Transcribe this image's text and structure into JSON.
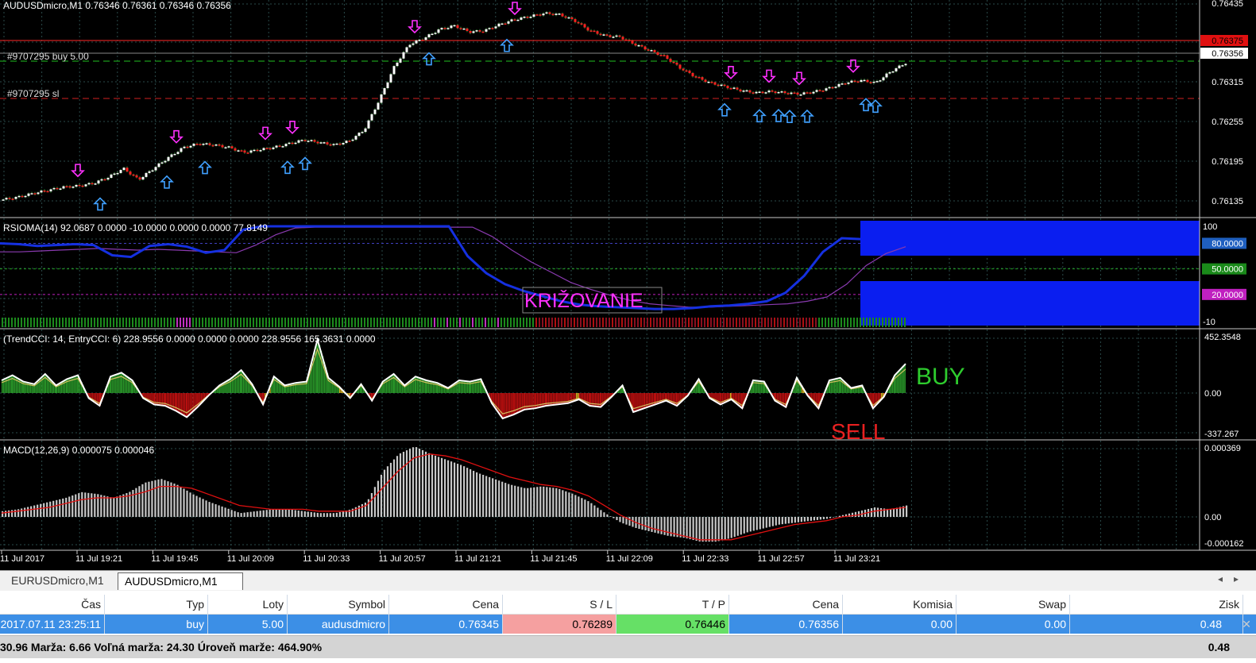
{
  "window": {
    "symbol_title": "AUDUSDmicro,M1  0.76346 0.76361 0.76346 0.76356",
    "bg_color": "#000000",
    "grid_color": "#2a4a4a",
    "bull_color": "#ffffff",
    "bear_color": "#ff2020",
    "up_arrow_color": "#40a0ff",
    "down_arrow_color": "#ff30ff"
  },
  "main_chart": {
    "order_label": "#9707295 buy 5.00",
    "sl_label": "#9707295 sl",
    "price_scale": [
      "0.76435",
      "0.76375",
      "0.76356",
      "0.76315",
      "0.76255",
      "0.76195",
      "0.76135"
    ],
    "current_price": "0.76356",
    "red_line_price": "0.76375",
    "close_series": [
      0.7613,
      0.76134,
      0.7614,
      0.76145,
      0.7615,
      0.76152,
      0.76156,
      0.76166,
      0.7618,
      0.76162,
      0.7618,
      0.76198,
      0.76214,
      0.7622,
      0.76218,
      0.76214,
      0.76206,
      0.7621,
      0.76214,
      0.7622,
      0.76226,
      0.76222,
      0.76218,
      0.76224,
      0.76242,
      0.7629,
      0.76344,
      0.7638,
      0.7639,
      0.76404,
      0.7641,
      0.764,
      0.76402,
      0.76412,
      0.7642,
      0.76425,
      0.7643,
      0.76428,
      0.76418,
      0.76402,
      0.76394,
      0.76392,
      0.7638,
      0.7637,
      0.7636,
      0.76342,
      0.76328,
      0.76318,
      0.76312,
      0.76306,
      0.76302,
      0.76304,
      0.76302,
      0.763,
      0.76304,
      0.7631,
      0.76318,
      0.76322,
      0.76318,
      0.76336,
      0.7635
    ],
    "buy_arrows_x": [
      126,
      210,
      258,
      362,
      384,
      540,
      638,
      912,
      956,
      980,
      994,
      1016,
      1090,
      1102
    ],
    "sell_arrows_x": [
      98,
      222,
      334,
      368,
      522,
      648,
      920,
      968,
      1006,
      1074
    ]
  },
  "rsioma": {
    "label": "RSIOMA(14) 92.0687 0.0000 -10.0000 0.0000 0.0000 77.8149",
    "scale": [
      "100",
      "80.0000",
      "50.0000",
      "20.0000",
      "-10"
    ],
    "annotation": "KRIŽOVANIE",
    "line_series": [
      80,
      79,
      77,
      78,
      79,
      78,
      66,
      64,
      77,
      79,
      76,
      69,
      72,
      96,
      100,
      100,
      100,
      100,
      100,
      100,
      100,
      100,
      100,
      100,
      100,
      65,
      45,
      32,
      24,
      18,
      12,
      8,
      6,
      5,
      4,
      3,
      3,
      4,
      6,
      7,
      9,
      12,
      22,
      42,
      70,
      86,
      85
    ],
    "signal_series": [
      70,
      70,
      71,
      72,
      73,
      74,
      73,
      72,
      73,
      72,
      71,
      70,
      69,
      78,
      90,
      98,
      99,
      99,
      99,
      99,
      99,
      99,
      99,
      99,
      99,
      88,
      72,
      58,
      46,
      34,
      26,
      19,
      13,
      9,
      7,
      5,
      5,
      6,
      7,
      8,
      9,
      12,
      17,
      32,
      54,
      68,
      76
    ]
  },
  "cci": {
    "label": "(TrendCCI: 14, EntryCCI: 6)  228.9556 0.0000 0.0000 0.0000 228.9556 165.3631 0.0000",
    "scale": [
      "452.3548",
      "0.00",
      "-337.267"
    ],
    "buy_text": "BUY",
    "sell_text": "SELL",
    "series": [
      100,
      140,
      90,
      70,
      150,
      60,
      110,
      140,
      -40,
      -100,
      130,
      160,
      100,
      -40,
      -90,
      -100,
      -140,
      -190,
      -110,
      -20,
      60,
      110,
      180,
      70,
      -90,
      130,
      60,
      80,
      90,
      420,
      120,
      50,
      -40,
      70,
      -60,
      90,
      150,
      60,
      130,
      100,
      80,
      40,
      100,
      90,
      110,
      -80,
      -200,
      -170,
      -130,
      -120,
      -100,
      -90,
      -80,
      -50,
      -100,
      -110,
      -30,
      60,
      -150,
      -120,
      -90,
      -60,
      -100,
      -20,
      110,
      -40,
      -90,
      -50,
      -120,
      100,
      90,
      -60,
      -110,
      120,
      -20,
      -120,
      100,
      120,
      40,
      60,
      -120,
      -30,
      140,
      230
    ]
  },
  "macd": {
    "label": "MACD(12,26,9) 0.000075 0.000046",
    "scale": [
      "0.000369",
      "0.00",
      "-0.000162"
    ],
    "hist": [
      3e-05,
      4e-05,
      6e-05,
      8e-05,
      0.0001,
      0.00013,
      0.00012,
      0.0001,
      0.00013,
      0.00018,
      0.0002,
      0.00017,
      0.00012,
      8e-05,
      5e-05,
      2e-05,
      3e-05,
      4e-05,
      4e-05,
      3e-05,
      2e-05,
      2e-05,
      4e-05,
      8e-05,
      0.00024,
      0.00033,
      0.00037,
      0.00033,
      0.0003,
      0.00027,
      0.00023,
      0.0002,
      0.00017,
      0.00015,
      0.00016,
      0.00015,
      0.00012,
      8e-05,
      2e-05,
      -3e-05,
      -6e-05,
      -8e-05,
      -0.0001,
      -0.00011,
      -0.00013,
      -0.00013,
      -0.00011,
      -8e-05,
      -6e-05,
      -4e-05,
      -3e-05,
      -2e-05,
      -1e-05,
      1e-05,
      3e-05,
      5e-05,
      4e-05,
      6e-05
    ],
    "signal": [
      2e-05,
      3e-05,
      4e-05,
      5e-05,
      7e-05,
      9e-05,
      0.0001,
      0.0001,
      0.00011,
      0.00013,
      0.00016,
      0.00016,
      0.00015,
      0.00012,
      9e-05,
      6e-05,
      5e-05,
      4e-05,
      4e-05,
      4e-05,
      3e-05,
      3e-05,
      3e-05,
      6e-05,
      0.00015,
      0.00024,
      0.00031,
      0.00033,
      0.00032,
      0.0003,
      0.00027,
      0.00024,
      0.00021,
      0.00019,
      0.00017,
      0.00016,
      0.00014,
      0.00011,
      6e-05,
      1e-05,
      -3e-05,
      -6e-05,
      -8e-05,
      -0.0001,
      -0.00012,
      -0.00012,
      -0.00012,
      -0.0001,
      -8e-05,
      -6e-05,
      -4e-05,
      -3e-05,
      -2e-05,
      0.0,
      1e-05,
      3e-05,
      4e-05,
      5e-05
    ]
  },
  "time_axis": [
    "11 Jul 2017",
    "11 Jul 19:21",
    "11 Jul 19:45",
    "11 Jul 20:09",
    "11 Jul 20:33",
    "11 Jul 20:57",
    "11 Jul 21:21",
    "11 Jul 21:45",
    "11 Jul 22:09",
    "11 Jul 22:33",
    "11 Jul 22:57",
    "11 Jul 23:21"
  ],
  "tabs": [
    "EURUSDmicro,M1",
    "AUDUSDmicro,M1"
  ],
  "terminal": {
    "headers": {
      "time": "Čas",
      "type": "Typ",
      "lots": "Loty",
      "symbol": "Symbol",
      "price": "Cena",
      "sl": "S / L",
      "tp": "T / P",
      "price2": "Cena",
      "commission": "Komisia",
      "swap": "Swap",
      "profit": "Zisk"
    },
    "row": {
      "time": "2017.07.11 23:25:11",
      "type": "buy",
      "lots": "5.00",
      "symbol": "audusdmicro",
      "price": "0.76345",
      "sl": "0.76289",
      "tp": "0.76446",
      "price2": "0.76356",
      "commission": "0.00",
      "swap": "0.00",
      "profit": "0.48"
    },
    "status_left": "30.96  Marža: 6.66  Voľná marža: 24.30  Úroveň marže: 464.90%",
    "status_right": "0.48"
  }
}
